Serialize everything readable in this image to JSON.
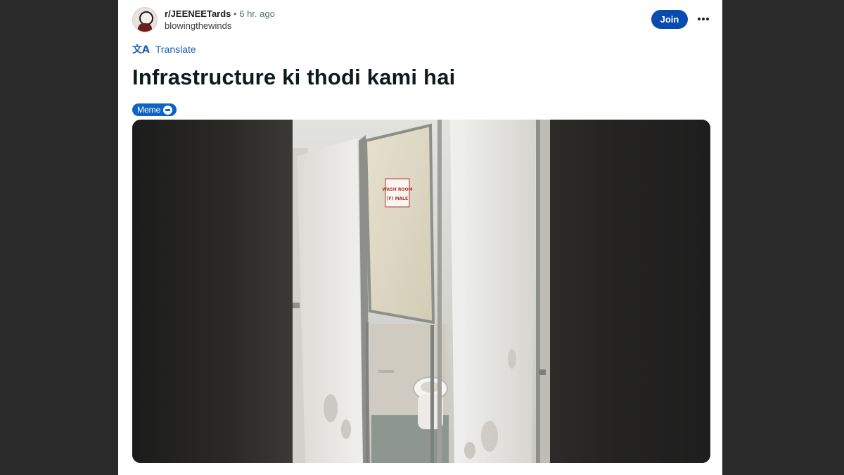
{
  "post": {
    "subreddit": "r/JEENEETards",
    "separator": "•",
    "time": "6 hr. ago",
    "author": "blowingthewinds",
    "join_label": "Join",
    "more_label": "•••",
    "translate_label": "Translate",
    "translate_icon": "文A",
    "title": "Infrastructure ki thodi kami hai",
    "flair": "Meme"
  },
  "image": {
    "sign_line1": "WASH ROOM",
    "sign_line2": "(F) MALE"
  },
  "colors": {
    "join": "#0a4bb0",
    "flair": "#0e63c4",
    "link": "#1d5fb8",
    "page_bg": "#2a2a2a"
  }
}
